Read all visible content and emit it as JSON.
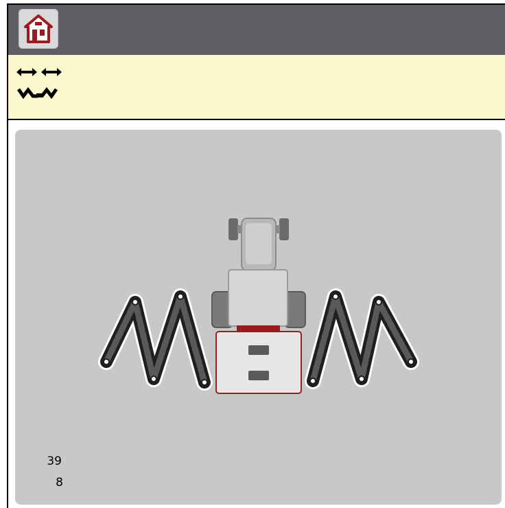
{
  "header": {
    "home_button_icon": "home-icon",
    "accent_color": "#9b1b1f"
  },
  "info_bar": {
    "mode_icon": "boom-width-fold-icon"
  },
  "viewport": {
    "vehicle_icon": "tractor-with-folding-boom",
    "counter_top": "39",
    "counter_bottom": "8"
  }
}
